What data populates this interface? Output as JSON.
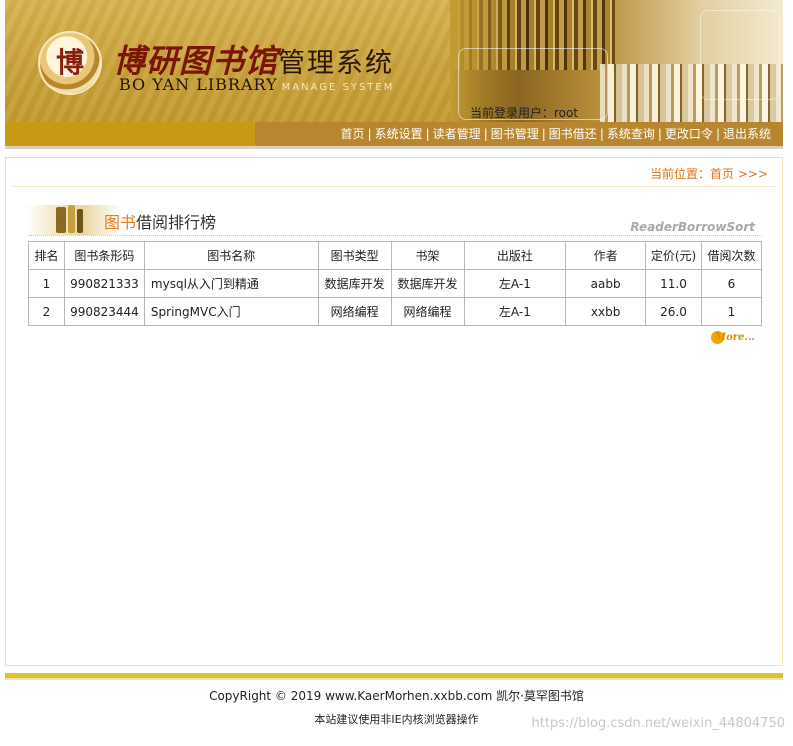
{
  "header": {
    "seal_glyph": "博",
    "logo_cn_bold": "博研图书馆",
    "logo_cn_plain": "管理系统",
    "logo_en": "BO YAN LIBRARY",
    "logo_en_sub": "MANAGE SYSTEM",
    "current_user_label": "当前登录用户：",
    "current_user": "root"
  },
  "nav": {
    "items": [
      {
        "label": "首页"
      },
      {
        "label": "系统设置"
      },
      {
        "label": "读者管理"
      },
      {
        "label": "图书管理"
      },
      {
        "label": "图书借还"
      },
      {
        "label": "系统查询"
      },
      {
        "label": "更改口令"
      },
      {
        "label": "退出系统"
      }
    ],
    "separator": "|"
  },
  "location": {
    "label": "当前位置：",
    "page": "首页",
    "arrows": ">>>"
  },
  "section": {
    "title_highlight": "图书",
    "title_rest": "借阅排行榜",
    "english": "ReaderBorrowSort"
  },
  "table": {
    "headers": [
      "排名",
      "图书条形码",
      "图书名称",
      "图书类型",
      "书架",
      "出版社",
      "作者",
      "定价(元)",
      "借阅次数"
    ],
    "rows": [
      [
        "1",
        "990821333",
        "mysql从入门到精通",
        "数据库开发",
        "数据库开发",
        "左A-1",
        "aabb",
        "11.0",
        "6"
      ],
      [
        "2",
        "990823444",
        "SpringMVC入门",
        "网络编程",
        "网络编程",
        "左A-1",
        "xxbb",
        "26.0",
        "1"
      ]
    ]
  },
  "more_label": "More...",
  "footer": {
    "copyright": "CopyRight © 2019 www.KaerMorhen.xxbb.com 凯尔·莫罕图书馆",
    "advice": "本站建议使用非IE内核浏览器操作",
    "watermark": "https://blog.csdn.net/weixin_44804750"
  },
  "colors": {
    "nav_left": "#c79a13",
    "nav_right": "#b8862e",
    "location_text": "#e0731a",
    "title_highlight": "#e87b1c",
    "footer_bar": "#e3bf2e"
  }
}
